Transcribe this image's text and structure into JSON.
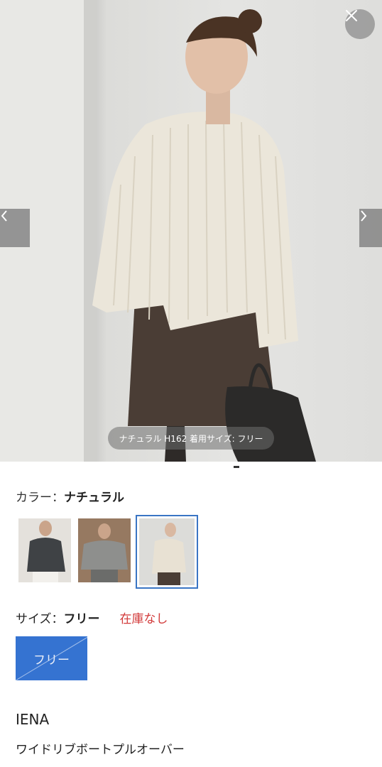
{
  "hero": {
    "caption": "ナチュラル H162 着用サイズ: フリー",
    "close_icon": "close-icon",
    "prev_icon": "chevron-left-icon",
    "next_icon": "chevron-right-icon"
  },
  "color": {
    "label": "カラー：",
    "selected": "ナチュラル",
    "swatches": [
      {
        "name": "charcoal",
        "color": "#3f4245"
      },
      {
        "name": "gray",
        "color": "#8e8f8d"
      },
      {
        "name": "natural",
        "color": "#e8e1d3",
        "selected": true
      }
    ]
  },
  "size": {
    "label": "サイズ：",
    "selected": "フリー",
    "stock_status": "在庫なし",
    "options": [
      {
        "label": "フリー",
        "selected": true,
        "available": false
      }
    ]
  },
  "product": {
    "brand": "IENA",
    "name": "ワイドリブボートプルオーバー"
  },
  "colors": {
    "accent": "#3573d1",
    "out_of_stock": "#d23a3a",
    "selected_border": "#3a75c4"
  }
}
